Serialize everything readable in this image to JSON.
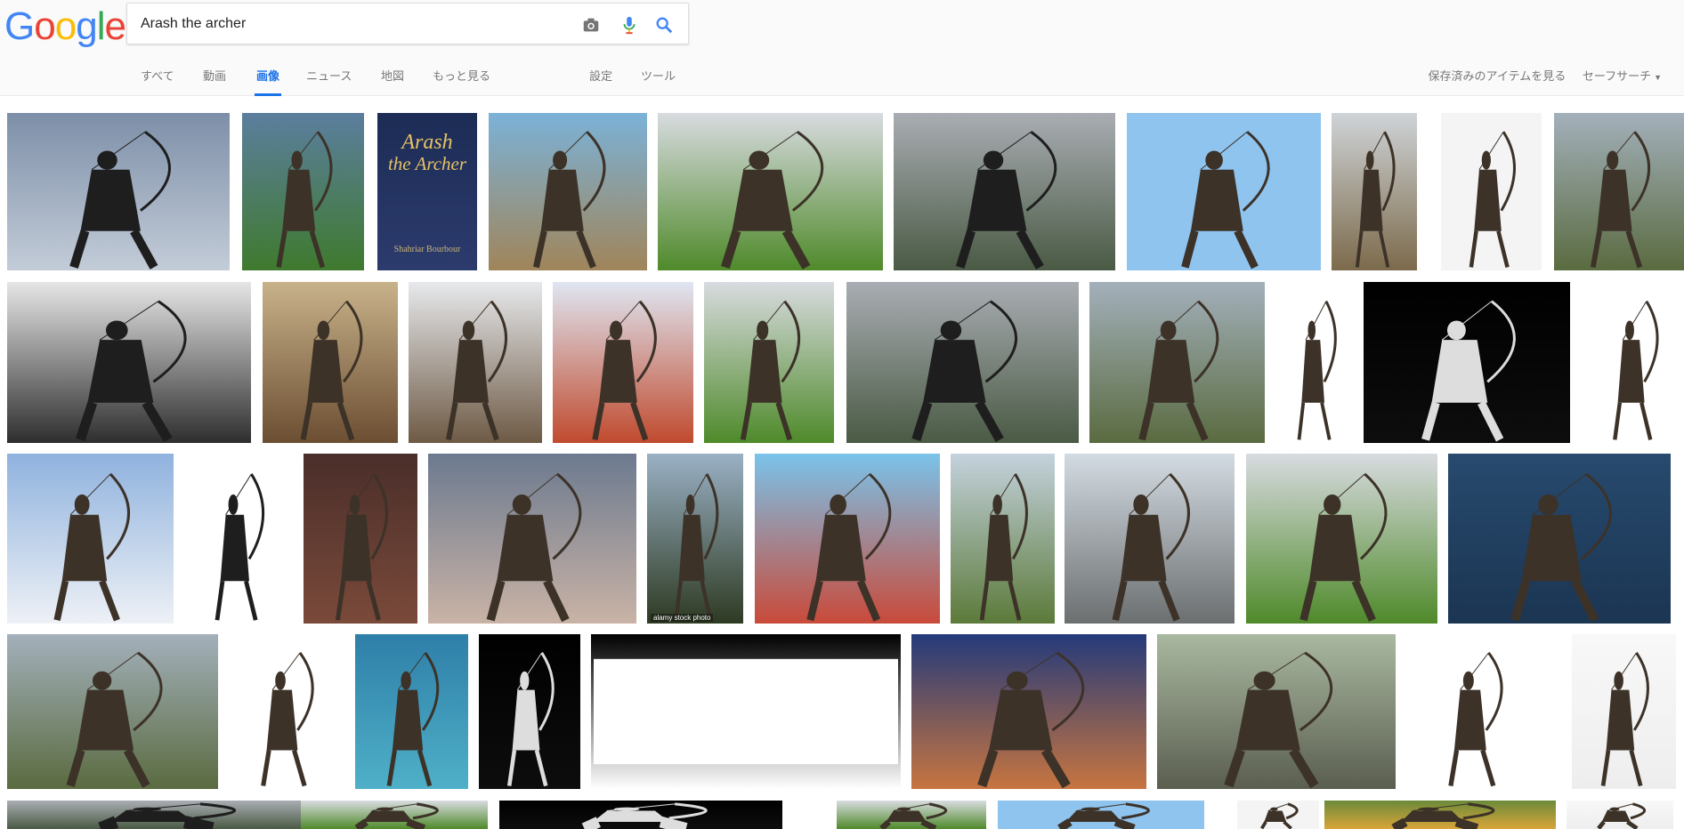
{
  "logo": {
    "letters": [
      "G",
      "o",
      "o",
      "g",
      "l",
      "e"
    ],
    "colors": [
      "#4285F4",
      "#EA4335",
      "#FBBC05",
      "#4285F4",
      "#34A853",
      "#EA4335"
    ]
  },
  "search": {
    "query": "Arash the archer"
  },
  "tabs": [
    {
      "label": "すべて",
      "active": false
    },
    {
      "label": "動画",
      "active": false
    },
    {
      "label": "画像",
      "active": true
    },
    {
      "label": "ニュース",
      "active": false
    },
    {
      "label": "地図",
      "active": false
    },
    {
      "label": "もっと見る",
      "active": false
    },
    {
      "label": "設定",
      "active": false
    },
    {
      "label": "ツール",
      "active": false
    }
  ],
  "right_links": {
    "saved": "保存済みのアイテムを見る",
    "safe_search": "セーフサーチ"
  },
  "icons": {
    "camera": "camera-icon",
    "mic": "mic-icon",
    "search": "search-icon",
    "caret": "caret-down-icon"
  },
  "book": {
    "title_line1": "Arash",
    "title_line2": "the Archer",
    "author": "Shahriar Bourbour"
  },
  "captions": {
    "alamy": "alamy stock photo"
  },
  "accent": "#1a73e8"
}
